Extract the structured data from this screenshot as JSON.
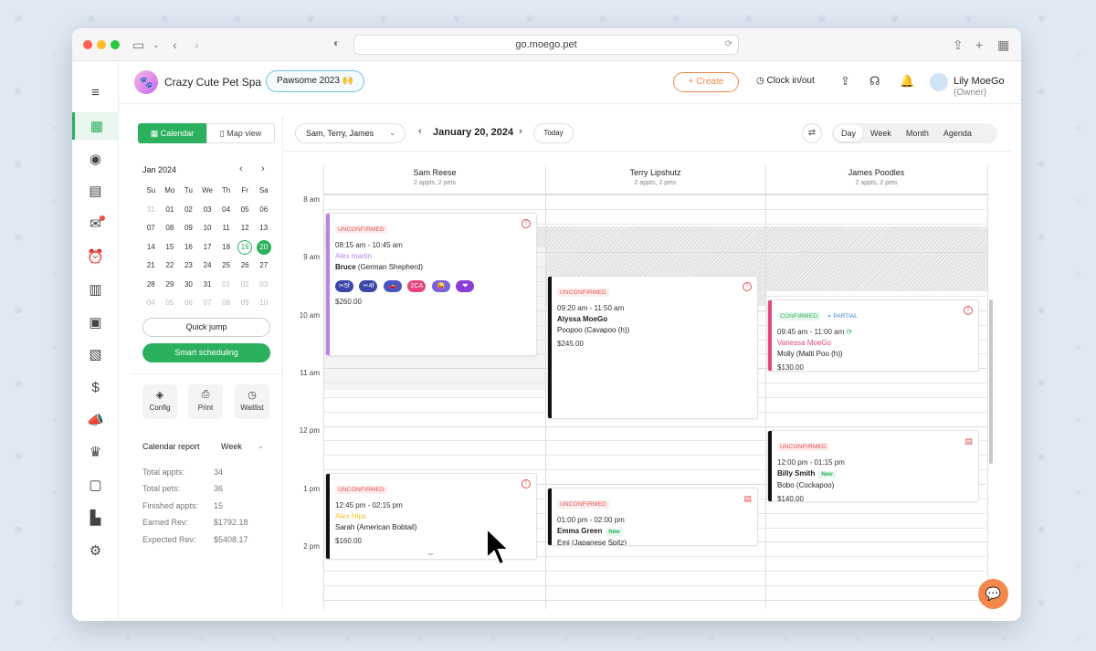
{
  "browser": {
    "url": "go.moego.pet"
  },
  "header": {
    "business_name": "Crazy Cute Pet Spa",
    "promo_label": "Pawsome 2023 🙌",
    "create_label": "+ Create",
    "clock_label": "Clock in/out",
    "user_name": "Lily MoeGo",
    "user_role": "(Owner)"
  },
  "sidebar_panel": {
    "calendar_tab": "Calendar",
    "map_tab": "Map view",
    "month_title": "Jan 2024",
    "weekdays": [
      "Su",
      "Mo",
      "Tu",
      "We",
      "Th",
      "Fr",
      "Sa"
    ],
    "weeks": [
      [
        "31",
        "01",
        "02",
        "03",
        "04",
        "05",
        "06"
      ],
      [
        "07",
        "08",
        "09",
        "10",
        "11",
        "12",
        "13"
      ],
      [
        "14",
        "15",
        "16",
        "17",
        "18",
        "19",
        "20"
      ],
      [
        "21",
        "22",
        "23",
        "24",
        "25",
        "26",
        "27"
      ],
      [
        "28",
        "29",
        "30",
        "31",
        "01",
        "02",
        "03"
      ],
      [
        "04",
        "05",
        "06",
        "07",
        "08",
        "09",
        "10"
      ]
    ],
    "today_day": "19",
    "selected_day": "20",
    "quick_jump_label": "Quick jump",
    "smart_scheduling_label": "Smart scheduling",
    "tools": {
      "config": "Config",
      "print": "Print",
      "waitlist": "Waitlist"
    },
    "report": {
      "title": "Calendar report",
      "period": "Week",
      "stats": [
        {
          "label": "Total appts:",
          "value": "34"
        },
        {
          "label": "Total pets:",
          "value": "36"
        },
        {
          "label": "Finished appts:",
          "value": "15"
        },
        {
          "label": "Earned Rev:",
          "value": "$1792.18"
        },
        {
          "label": "Expected Rev:",
          "value": "$5408.17"
        }
      ]
    }
  },
  "toolbar": {
    "staff_filter": "Sam, Terry, James",
    "date_label": "January 20, 2024",
    "today_label": "Today",
    "views": {
      "day": "Day",
      "week": "Week",
      "month": "Month",
      "agenda": "Agenda"
    },
    "active_view": "Day"
  },
  "calendar": {
    "hours": [
      "8 am",
      "9 am",
      "10 am",
      "11 am",
      "12 pm",
      "1 pm",
      "2 pm"
    ],
    "staff": [
      {
        "name": "Sam Reese",
        "sub": "2 appts, 2 pets"
      },
      {
        "name": "Terry Lipshutz",
        "sub": "2 appts, 2 pets"
      },
      {
        "name": "James Poodles",
        "sub": "2 appts, 2 pets"
      }
    ],
    "appointments": {
      "a1": {
        "status": "UNCONFIRMED",
        "time": "08:15 am - 10:45 am",
        "client": "Alex martin",
        "pet_name": "Bruce",
        "pet_breed": "(German Shepherd)",
        "price": "$260.00",
        "pills": [
          "5f",
          "4f",
          "",
          "2CA",
          "",
          ""
        ]
      },
      "a2": {
        "status": "UNCONFIRMED",
        "time": "09:20 am - 11:50 am",
        "client": "Alyssa MoeGo",
        "pet_name": "Poopoo",
        "pet_breed": "(Cavapoo (h))",
        "price": "$245.00"
      },
      "a3": {
        "status": "CONFIRMED",
        "payment": "PARTIAL",
        "time": "09:45 am - 11:00 am",
        "client": "Vanessa MoeGo",
        "pet_name": "Molly",
        "pet_breed": "(Malti Poo (h))",
        "price": "$130.00"
      },
      "a4": {
        "status": "UNCONFIRMED",
        "time": "12:00 pm - 01:15 pm",
        "client": "Billy Smith",
        "client_tag": "New",
        "pet_name": "Bobo",
        "pet_breed": "(Cockapoo)",
        "price": "$140.00"
      },
      "a5": {
        "status": "UNCONFIRMED",
        "time": "12:45 pm - 02:15 pm",
        "client": "Alex Hips",
        "pet_name": "Sarah",
        "pet_breed": "(American Bobtail)",
        "price": "$160.00"
      },
      "a6": {
        "status": "UNCONFIRMED",
        "time": "01:00 pm - 02:00 pm",
        "client": "Emma Green",
        "client_tag": "New",
        "pet_name": "Emi",
        "pet_breed": "(Japanese Spitz)"
      }
    }
  },
  "colors": {
    "brand_green": "#2bb05d",
    "accent_orange": "#f3884b",
    "alert_red": "#e44d4d"
  }
}
